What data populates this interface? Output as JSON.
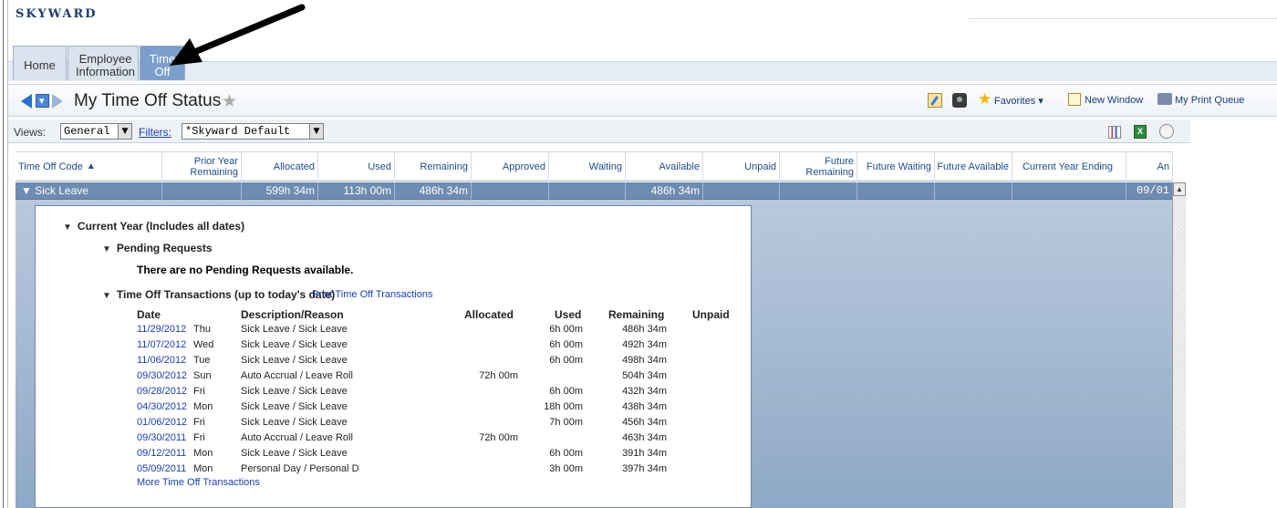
{
  "app": {
    "logo": "SKYWARD"
  },
  "nav": {
    "tabs": [
      {
        "label": "Home"
      },
      {
        "label": "Employee Information"
      },
      {
        "label": "Time Off"
      }
    ]
  },
  "title_bar": {
    "title": "My Time Off Status",
    "favorites_label": "Favorites ▾",
    "new_window_label": "New Window",
    "print_queue_label": "My Print Queue"
  },
  "views": {
    "views_label": "Views:",
    "views_value": "General",
    "filters_label": "Filters:",
    "filters_value": "*Skyward Default"
  },
  "table": {
    "headers": [
      "Time Off Code",
      "Prior Year Remaining",
      "Allocated",
      "Used",
      "Remaining",
      "Approved",
      "Waiting",
      "Available",
      "Unpaid",
      "Future Remaining",
      "Future Waiting",
      "Future Available",
      "Current Year Ending",
      "An"
    ],
    "row": {
      "code": "Sick Leave",
      "prior_year": "",
      "allocated": "599h 34m",
      "used": "113h 00m",
      "remaining": "486h 34m",
      "approved": "",
      "waiting": "",
      "available": "486h 34m",
      "unpaid": "",
      "future_remaining": "",
      "future_waiting": "",
      "future_available": "",
      "current_year_ending": "",
      "anniversary": "09/01"
    }
  },
  "details": {
    "current_year": "Current Year (Includes all dates)",
    "pending_requests": "Pending Requests",
    "no_pending": "There are no Pending Requests available.",
    "transactions_heading": "Time Off Transactions (up to today's date)",
    "print_link": "Print Time Off Transactions",
    "tx_headers": {
      "date": "Date",
      "desc": "Description/Reason",
      "allocated": "Allocated",
      "used": "Used",
      "remaining": "Remaining",
      "unpaid": "Unpaid"
    },
    "transactions": [
      {
        "date": "11/29/2012",
        "dow": "Thu",
        "desc": "Sick Leave / Sick Leave",
        "allocated": "",
        "used": "6h 00m",
        "remaining": "486h 34m"
      },
      {
        "date": "11/07/2012",
        "dow": "Wed",
        "desc": "Sick Leave / Sick Leave",
        "allocated": "",
        "used": "6h 00m",
        "remaining": "492h 34m"
      },
      {
        "date": "11/06/2012",
        "dow": "Tue",
        "desc": "Sick Leave / Sick Leave",
        "allocated": "",
        "used": "6h 00m",
        "remaining": "498h 34m"
      },
      {
        "date": "09/30/2012",
        "dow": "Sun",
        "desc": "Auto Accrual / Leave Roll",
        "allocated": "72h 00m",
        "used": "",
        "remaining": "504h 34m"
      },
      {
        "date": "09/28/2012",
        "dow": "Fri",
        "desc": "Sick Leave / Sick Leave",
        "allocated": "",
        "used": "6h 00m",
        "remaining": "432h 34m"
      },
      {
        "date": "04/30/2012",
        "dow": "Mon",
        "desc": "Sick Leave / Sick Leave",
        "allocated": "",
        "used": "18h 00m",
        "remaining": "438h 34m"
      },
      {
        "date": "01/06/2012",
        "dow": "Fri",
        "desc": "Sick Leave / Sick Leave",
        "allocated": "",
        "used": "7h 00m",
        "remaining": "456h 34m"
      },
      {
        "date": "09/30/2011",
        "dow": "Fri",
        "desc": "Auto Accrual / Leave Roll",
        "allocated": "72h 00m",
        "used": "",
        "remaining": "463h 34m"
      },
      {
        "date": "09/12/2011",
        "dow": "Mon",
        "desc": "Sick Leave / Sick Leave",
        "allocated": "",
        "used": "6h 00m",
        "remaining": "391h 34m"
      },
      {
        "date": "05/09/2011",
        "dow": "Mon",
        "desc": "Personal Day / Personal D",
        "allocated": "",
        "used": "3h 00m",
        "remaining": "397h 34m"
      }
    ],
    "more_link": "More Time Off Transactions"
  }
}
